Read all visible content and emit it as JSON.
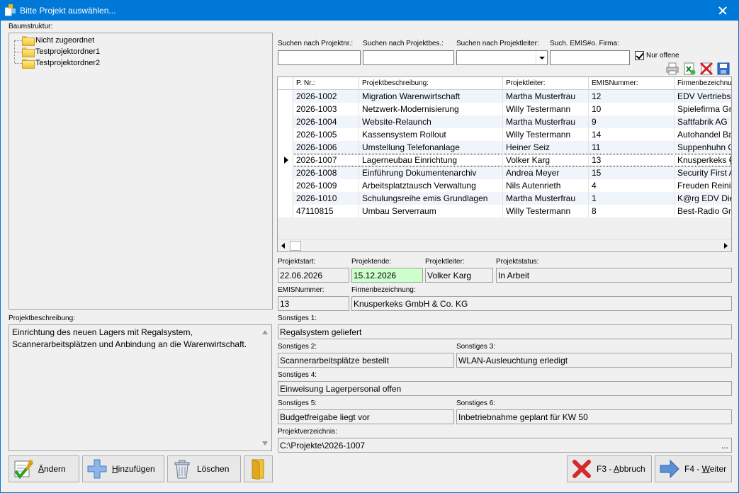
{
  "window": {
    "title": "Bitte Projekt auswählen...",
    "accent": "#0078d7"
  },
  "tree": {
    "label": "Baumstruktur:",
    "items": [
      "Nicht zugeordnet",
      "Testprojektordner1",
      "Testprojektordner2"
    ]
  },
  "search": {
    "nr_label": "Suchen nach Projektnr.:",
    "desc_label": "Suchen nach Projektbes.:",
    "leader_label": "Suchen nach Projektleiter:",
    "emis_label": "Such. EMIS#o. Firma:",
    "only_open_label": "Nur offene",
    "only_open_checked": true,
    "nr_value": "",
    "desc_value": "",
    "leader_value": "",
    "emis_value": ""
  },
  "toolbar": {
    "icons": [
      "print-icon",
      "export-excel-icon",
      "delete-filter-icon",
      "save-icon"
    ]
  },
  "grid": {
    "headers": [
      "P. Nr.:",
      "Projektbeschreibung:",
      "Projektleiter:",
      "EMISNummer:",
      "Firmenbezeichnung:"
    ],
    "selected_index": 5,
    "rows": [
      [
        "2026-1002",
        "Migration Warenwirtschaft",
        "Martha Musterfrau",
        "12",
        "EDV Vertriebsge"
      ],
      [
        "2026-1003",
        "Netzwerk-Modernisierung",
        "Willy Testermann",
        "10",
        "Spielefirma Gr"
      ],
      [
        "2026-1004",
        "Website-Relaunch",
        "Martha Musterfrau",
        "9",
        "Saftfabrik AG"
      ],
      [
        "2026-1005",
        "Kassensystem Rollout",
        "Willy Testermann",
        "14",
        "Autohandel Ba"
      ],
      [
        "2026-1006",
        "Umstellung Telefonanlage",
        "Heiner Seiz",
        "11",
        "Suppenhuhn G"
      ],
      [
        "2026-1007",
        "Lagerneubau Einrichtung",
        "Volker Karg",
        "13",
        "Knusperkeks G"
      ],
      [
        "2026-1008",
        "Einführung Dokumentenarchiv",
        "Andrea Meyer",
        "15",
        "Security First A"
      ],
      [
        "2026-1009",
        "Arbeitsplatztausch Verwaltung",
        "Nils Autenrieth",
        "4",
        "Freuden Reinig"
      ],
      [
        "2026-1010",
        "Schulungsreihe emis Grundlagen",
        "Martha Musterfrau",
        "1",
        "K@rg EDV Dien"
      ],
      [
        "47110815",
        "Umbau Serverraum",
        "Willy Testermann",
        "8",
        "Best-Radio Gm"
      ]
    ]
  },
  "details": {
    "start_label": "Projektstart:",
    "start": "22.06.2026",
    "end_label": "Projektende:",
    "end": "15.12.2026",
    "leader_label": "Projektleiter:",
    "leader": "Volker Karg",
    "status_label": "Projektstatus:",
    "status": "In Arbeit",
    "emis_label": "EMISNummer:",
    "emis": "13",
    "company_label": "Firmenbezeichnung:",
    "company": "Knusperkeks GmbH & Co. KG",
    "s1_label": "Sonstiges 1:",
    "s1": "Regalsystem geliefert",
    "s2_label": "Sonstiges 2:",
    "s2": "Scannerarbeitsplätze bestellt",
    "s3_label": "Sonstiges 3:",
    "s3": "WLAN-Ausleuchtung erledigt",
    "s4_label": "Sonstiges 4:",
    "s4": "Einweisung Lagerpersonal offen",
    "s5_label": "Sonstiges 5:",
    "s5": "Budgetfreigabe liegt vor",
    "s6_label": "Sonstiges 6:",
    "s6": "Inbetriebnahme geplant für KW 50",
    "dir_label": "Projektverzeichnis:",
    "dir": "C:\\Projekte\\2026-1007",
    "dir_browse": "...",
    "end_highlight": "#ccffcc"
  },
  "description": {
    "label": "Projektbeschreibung:",
    "text": "Einrichtung des neuen Lagers mit Regalsystem, Scannerarbeitsplätzen und Anbindung an die Warenwirtschaft."
  },
  "buttons": {
    "edit_prefix": "",
    "edit_key": "Ä",
    "edit_rest": "ndern",
    "add_prefix": "",
    "add_key": "H",
    "add_rest": "inzufügen",
    "delete_label": "Löschen",
    "cancel_prefix": "F3 - ",
    "cancel_key": "A",
    "cancel_rest": "bbruch",
    "next_prefix": "F4 - ",
    "next_key": "W",
    "next_rest": "eiter"
  }
}
